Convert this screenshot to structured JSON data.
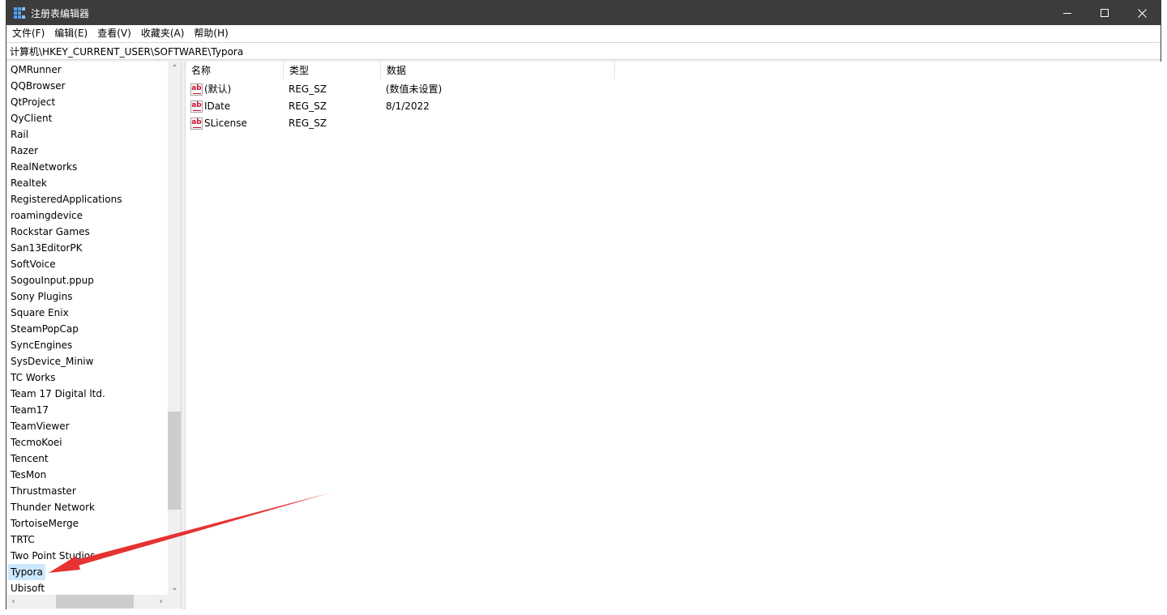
{
  "window": {
    "title": "注册表编辑器",
    "accent_arrow_color": "#e63232",
    "selection_color": "#cce8ff"
  },
  "titlebar_icons": {
    "app": "registry-editor-icon",
    "minimize": "minimize-icon",
    "maximize": "maximize-icon",
    "close": "close-icon"
  },
  "menu": [
    "文件(F)",
    "编辑(E)",
    "查看(V)",
    "收藏夹(A)",
    "帮助(H)"
  ],
  "address": {
    "path": "计算机\\HKEY_CURRENT_USER\\SOFTWARE\\Typora"
  },
  "tree": {
    "items": [
      "QMRunner",
      "QQBrowser",
      "QtProject",
      "QyClient",
      "Rail",
      "Razer",
      "RealNetworks",
      "Realtek",
      "RegisteredApplications",
      "roamingdevice",
      "Rockstar Games",
      "San13EditorPK",
      "SoftVoice",
      "SogouInput.ppup",
      "Sony Plugins",
      "Square Enix",
      "SteamPopCap",
      "SyncEngines",
      "SysDevice_Miniw",
      "TC Works",
      "Team 17 Digital ltd.",
      "Team17",
      "TeamViewer",
      "TecmoKoei",
      "Tencent",
      "TesMon",
      "Thrustmaster",
      "Thunder Network",
      "TortoiseMerge",
      "TRTC",
      "Two Point Studios",
      "Typora",
      "Ubisoft"
    ],
    "selected": "Typora"
  },
  "list": {
    "columns": [
      "名称",
      "类型",
      "数据"
    ],
    "rows": [
      {
        "name": "(默认)",
        "type": "REG_SZ",
        "data": "(数值未设置)",
        "icon": "ab-string-icon"
      },
      {
        "name": "IDate",
        "type": "REG_SZ",
        "data": "8/1/2022",
        "icon": "ab-string-icon"
      },
      {
        "name": "SLicense",
        "type": "REG_SZ",
        "data": "",
        "icon": "ab-string-icon"
      }
    ],
    "icon_glyph": "ab"
  }
}
